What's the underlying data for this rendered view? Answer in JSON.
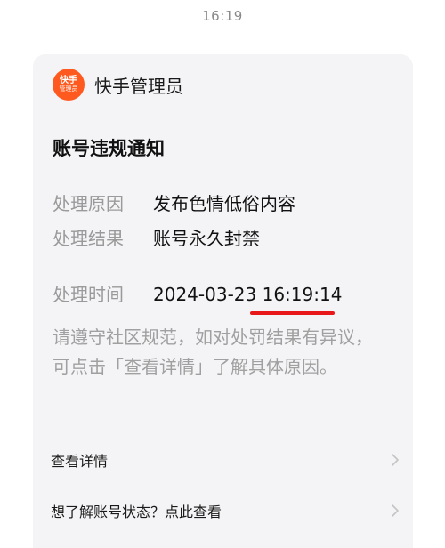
{
  "status_bar": {
    "time": "16:19"
  },
  "message": {
    "sender": {
      "name": "快手管理员",
      "avatar_line1": "快手",
      "avatar_line2": "管理员",
      "avatar_color": "#fe5a1f"
    },
    "title": "账号违规通知",
    "fields": [
      {
        "label": "处理原因",
        "value": "发布色情低俗内容"
      },
      {
        "label": "处理结果",
        "value": "账号永久封禁"
      },
      {
        "label": "处理时间",
        "value": "2024-03-23 16:19:14"
      }
    ],
    "description": "请遵守社区规范，如对处罚结果有异议，可点击「查看详情」了解具体原因。",
    "actions": [
      {
        "label": "查看详情",
        "icon": "chevron-right-icon"
      },
      {
        "label": "想了解账号状态？点此查看",
        "icon": "chevron-right-icon"
      }
    ]
  },
  "colors": {
    "card_background": "#f4f4f6",
    "highlight_underline": "#e8181a",
    "muted_text": "#9a9a9a"
  }
}
